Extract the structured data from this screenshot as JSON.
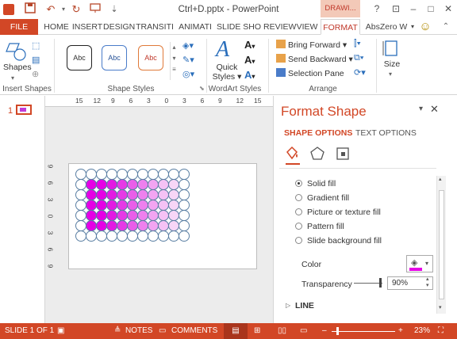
{
  "window": {
    "title": "Ctrl+D.pptx - PowerPoint",
    "contextual_tab": "DRAWI...",
    "min": "–",
    "max": "□",
    "close": "✕",
    "help": "?",
    "ribbon_opts": "⊡"
  },
  "tabs": {
    "file": "FILE",
    "items": [
      "HOME",
      "INSERT",
      "DESIGN",
      "TRANSITI",
      "ANIMATI",
      "SLIDE SHO",
      "REVIEW",
      "VIEW",
      "FORMAT"
    ],
    "user": "AbsZero W",
    "smiley": "☺"
  },
  "ribbon": {
    "insert_shapes": {
      "label": "Insert Shapes",
      "shapes_btn": "Shapes"
    },
    "shape_styles": {
      "label": "Shape Styles",
      "samples": [
        "Abc",
        "Abc",
        "Abc"
      ]
    },
    "wordart": {
      "label": "WordArt Styles",
      "quick_styles": "Quick Styles",
      "quick_line1": "Quick",
      "quick_line2": "Styles",
      "A": "A"
    },
    "arrange": {
      "label": "Arrange",
      "bring_forward": "Bring Forward",
      "send_backward": "Send Backward",
      "selection_pane": "Selection Pane"
    },
    "size": {
      "label": "Size"
    }
  },
  "thumbs": {
    "slide_number": "1"
  },
  "ruler": {
    "h": [
      "15",
      "12",
      "9",
      "6",
      "3",
      "0",
      "3",
      "6",
      "9",
      "12",
      "15"
    ],
    "v": [
      "9",
      "6",
      "3",
      "0",
      "3",
      "6",
      "9"
    ]
  },
  "grid": {
    "rows": 7,
    "cols": 11,
    "filled_rows": [
      1,
      5
    ],
    "filled_cols": [
      1,
      9
    ],
    "colors": [
      "#e600e6",
      "#e600e6",
      "#e31ae3",
      "#e63ae6",
      "#e95ee9",
      "#ee80ee",
      "#f2a5f2",
      "#f5c2f5",
      "#f7d6f7"
    ]
  },
  "format_pane": {
    "title": "Format Shape",
    "tab_shape": "SHAPE OPTIONS",
    "tab_text": "TEXT OPTIONS",
    "fill_options": [
      "Solid fill",
      "Gradient fill",
      "Picture or texture fill",
      "Pattern fill",
      "Slide background fill"
    ],
    "selected_fill": "Solid fill",
    "color_label": "Color",
    "transparency_label": "Transparency",
    "transparency_value": "90%",
    "transparency": 0.9,
    "line_label": "LINE"
  },
  "status": {
    "slide_of": "SLIDE 1 OF 1",
    "notes": "NOTES",
    "comments": "COMMENTS",
    "zoom": "23%",
    "minus": "–",
    "plus": "+"
  },
  "colors": {
    "accent": "#d24726",
    "fill_color": "#e600e6"
  }
}
